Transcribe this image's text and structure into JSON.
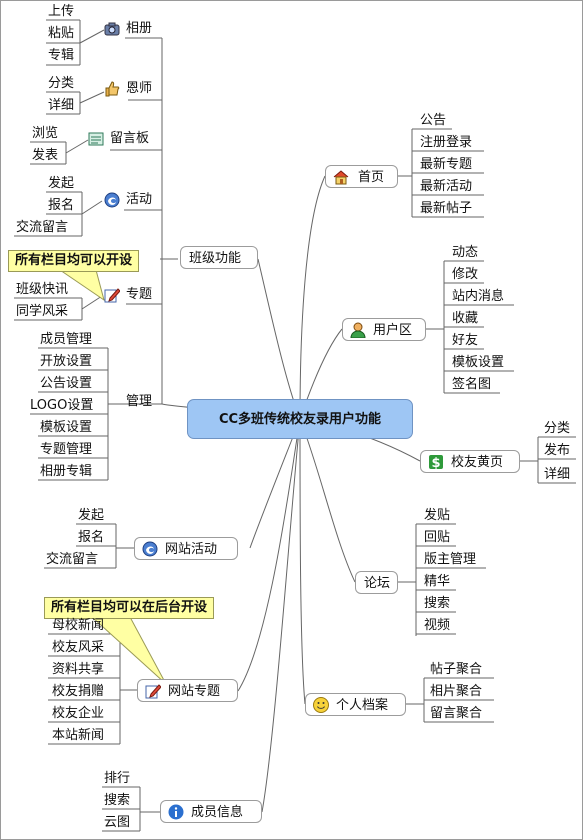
{
  "center": "CC多班传统校友录用户功能",
  "callouts": [
    "所有栏目均可以开设",
    "所有栏目均可以在后台开设"
  ],
  "left": {
    "bangji": {
      "label": "班级功能",
      "album": {
        "label": "相册",
        "icon": "camera-icon",
        "items": [
          "上传",
          "粘贴",
          "专辑"
        ]
      },
      "teacher": {
        "label": "恩师",
        "icon": "thumbs-up-icon",
        "items": [
          "分类",
          "详细"
        ]
      },
      "board": {
        "label": "留言板",
        "icon": "message-board-icon",
        "items": [
          "浏览",
          "发表"
        ]
      },
      "activity": {
        "label": "活动",
        "icon": "swirl-icon",
        "items": [
          "发起",
          "报名",
          "交流留言"
        ]
      },
      "topic": {
        "label": "专题",
        "icon": "pencil-icon",
        "items": [
          "班级快讯",
          "同学风采"
        ]
      },
      "manage": {
        "label": "管理",
        "items": [
          "成员管理",
          "开放设置",
          "公告设置",
          "LOGO设置",
          "模板设置",
          "专题管理",
          "相册专辑"
        ]
      }
    },
    "site_activity": {
      "label": "网站活动",
      "icon": "swirl-icon",
      "items": [
        "发起",
        "报名",
        "交流留言"
      ]
    },
    "site_topic": {
      "label": "网站专题",
      "icon": "pencil-icon",
      "items": [
        "母校新闻",
        "校友风采",
        "资料共享",
        "校友捐赠",
        "校友企业",
        "本站新闻"
      ]
    },
    "members": {
      "label": "成员信息",
      "icon": "info-icon",
      "items": [
        "排行",
        "搜索",
        "云图"
      ]
    }
  },
  "right": {
    "home": {
      "label": "首页",
      "icon": "house-icon",
      "items": [
        "公告",
        "注册登录",
        "最新专题",
        "最新活动",
        "最新帖子"
      ]
    },
    "user": {
      "label": "用户区",
      "icon": "user-icon",
      "items": [
        "动态",
        "修改",
        "站内消息",
        "收藏",
        "好友",
        "模板设置",
        "签名图"
      ]
    },
    "yellow": {
      "label": "校友黄页",
      "icon": "dollar-icon",
      "items": [
        "分类",
        "发布",
        "详细"
      ]
    },
    "forum": {
      "label": "论坛",
      "items": [
        "发贴",
        "回贴",
        "版主管理",
        "精华",
        "搜索",
        "视频"
      ]
    },
    "profile": {
      "label": "个人档案",
      "icon": "smiley-icon",
      "items": [
        "帖子聚合",
        "相片聚合",
        "留言聚合"
      ]
    }
  }
}
